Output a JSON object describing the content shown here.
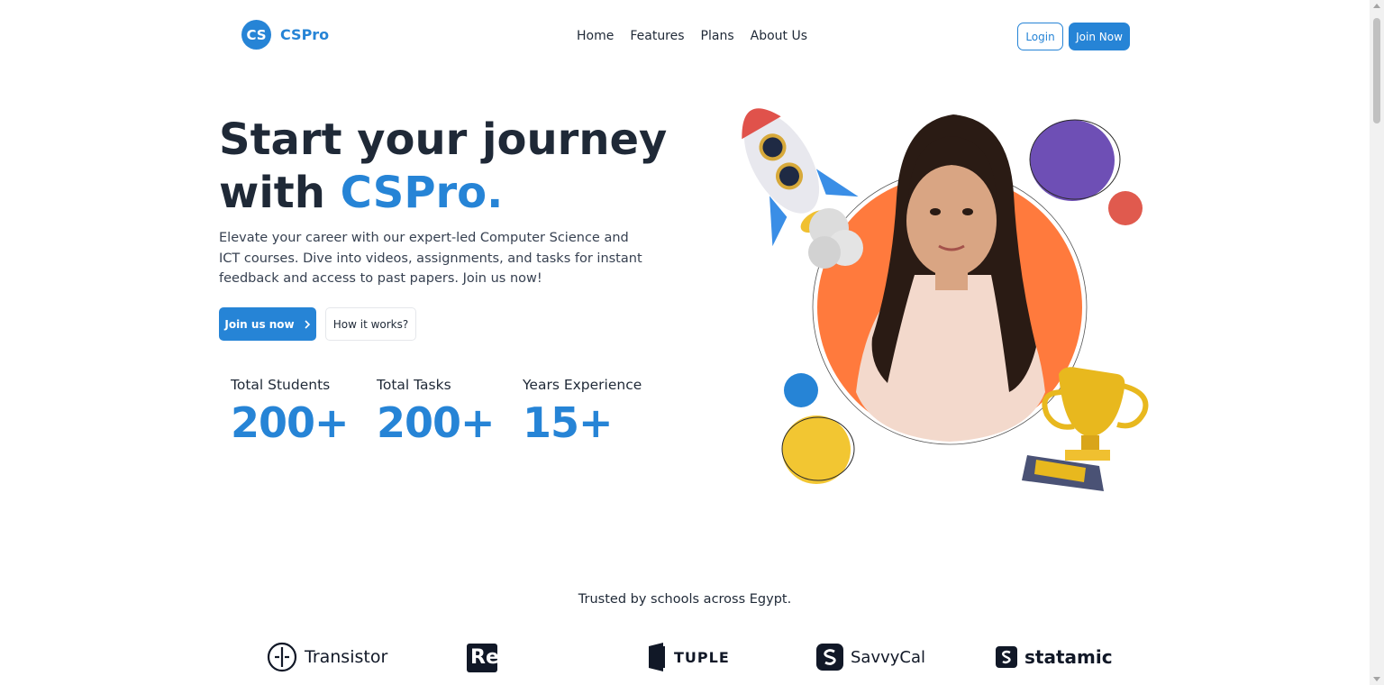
{
  "brand": {
    "badge": "CS",
    "name": "CSPro"
  },
  "nav": {
    "items": [
      "Home",
      "Features",
      "Plans",
      "About Us"
    ]
  },
  "header_actions": {
    "login": "Login",
    "join": "Join Now"
  },
  "hero": {
    "title_line1": "Start your journey",
    "title_line2_prefix": "with ",
    "title_accent": "CSPro.",
    "description": "Elevate your career with our expert-led Computer Science and ICT courses. Dive into videos, assignments, and tasks for instant feedback and access to past papers. Join us now!",
    "primary_cta": "Join us now",
    "secondary_cta": "How it works?"
  },
  "stats": [
    {
      "label": "Total Students",
      "value": "200+"
    },
    {
      "label": "Total Tasks",
      "value": "200+"
    },
    {
      "label": "Years Experience",
      "value": "15+"
    }
  ],
  "trusted": {
    "heading": "Trusted by schools across Egypt.",
    "logos": [
      "Transistor",
      "Reform",
      "TUPLE",
      "SavvyCal",
      "statamic"
    ]
  },
  "colors": {
    "accent": "#2684d6",
    "text": "#1f2937",
    "orange": "#ff7a3d",
    "purple": "#6e4fb5",
    "red": "#e05a4e",
    "yellow": "#f2c632"
  },
  "icons": [
    "chevron-right-icon",
    "rocket-icon",
    "trophy-icon"
  ]
}
